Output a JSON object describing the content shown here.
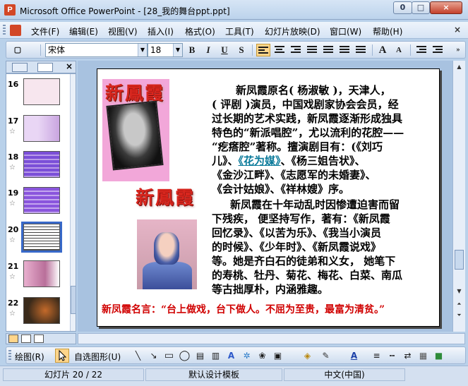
{
  "window": {
    "title": "Microsoft Office PowerPoint - [28_我的舞台ppt.ppt]",
    "app_icon": "P",
    "minimize": "0",
    "maximize": "□",
    "close": "×"
  },
  "menu": {
    "items": [
      "文件(F)",
      "编辑(E)",
      "视图(V)",
      "插入(I)",
      "格式(O)",
      "工具(T)",
      "幻灯片放映(D)",
      "窗口(W)",
      "帮助(H)"
    ],
    "close": "×"
  },
  "toolbar": {
    "font_name": "宋体",
    "font_size": "18",
    "bold": "B",
    "italic": "I",
    "underline": "U",
    "shadow": "S",
    "grow_font": "A",
    "shrink_font": "A"
  },
  "thumbnails": [
    {
      "num": "16",
      "star": "",
      "color": "#f7e6ee"
    },
    {
      "num": "17",
      "star": "☆",
      "color": "#e9d6f5"
    },
    {
      "num": "18",
      "star": "☆",
      "color": "#7b4fd8"
    },
    {
      "num": "19",
      "star": "☆",
      "color": "#8a55dd"
    },
    {
      "num": "20",
      "star": "☆",
      "color": "#ffffff",
      "selected": true
    },
    {
      "num": "21",
      "star": "☆",
      "color": "#d9a6c8"
    },
    {
      "num": "22",
      "star": "☆",
      "color": "#3a2a1a"
    }
  ],
  "slide": {
    "title_art_1": "新鳳霞",
    "title_art_2": "新鳳霞",
    "para1": {
      "lines": [
        "新凤霞原名( 杨淑敏 )，天津人，",
        "( 评剧 )演员，中国戏剧家协会会员，经",
        "过长期的艺术实践，新凤霞逐渐形成独具",
        "特色的“新派唱腔”，尤以流利的花腔——",
        "“疙瘩腔”著称。擅演剧目有：(《刘巧"
      ],
      "line6_pre": "儿》、",
      "link": "《花为媒》",
      "line6_post": "、《杨三姐告状》、",
      "line7": "《金沙江畔》、《志愿军的未婚妻》、",
      "line8": "《会计姑娘》、《祥林嫂》序。"
    },
    "para2": {
      "lines": [
        "新凤霞在十年动乱时因惨遭迫害而留",
        "下残疾， 便坚持写作，著有：《新凤霞",
        "回忆录》、《以苦为乐》、《我当小演员",
        "的时候》、《少年时》、《新凤霞说戏》",
        "等。她是齐白石的徒弟和义女， 她笔下",
        "的寿桃、牡丹、菊花、梅花、白菜、南瓜",
        "等古拙厚朴，内涵雅趣。"
      ]
    },
    "quote": "新凤霞名言：“台上做戏，台下做人。不屈为至贵，最富为清贫。”"
  },
  "drawbar": {
    "draw_label": "绘图(R)",
    "autoshape_label": "自选图形(U)"
  },
  "status": {
    "slide_pos": "幻灯片 20 / 22",
    "template": "默认设计模板",
    "language": "中文(中国)"
  }
}
